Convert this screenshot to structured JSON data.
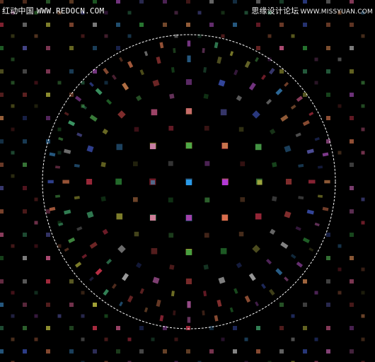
{
  "watermark_left": {
    "site_name": "红动中国",
    "url": "WWW.REDOCN.COM"
  },
  "watermark_right": {
    "site_name": "思缘设计论坛",
    "url": "WWW.MISSYUAN.COM"
  },
  "colors": {
    "background": "#000000",
    "selection": "#ffffff",
    "watermark_text": "#ffffff"
  }
}
